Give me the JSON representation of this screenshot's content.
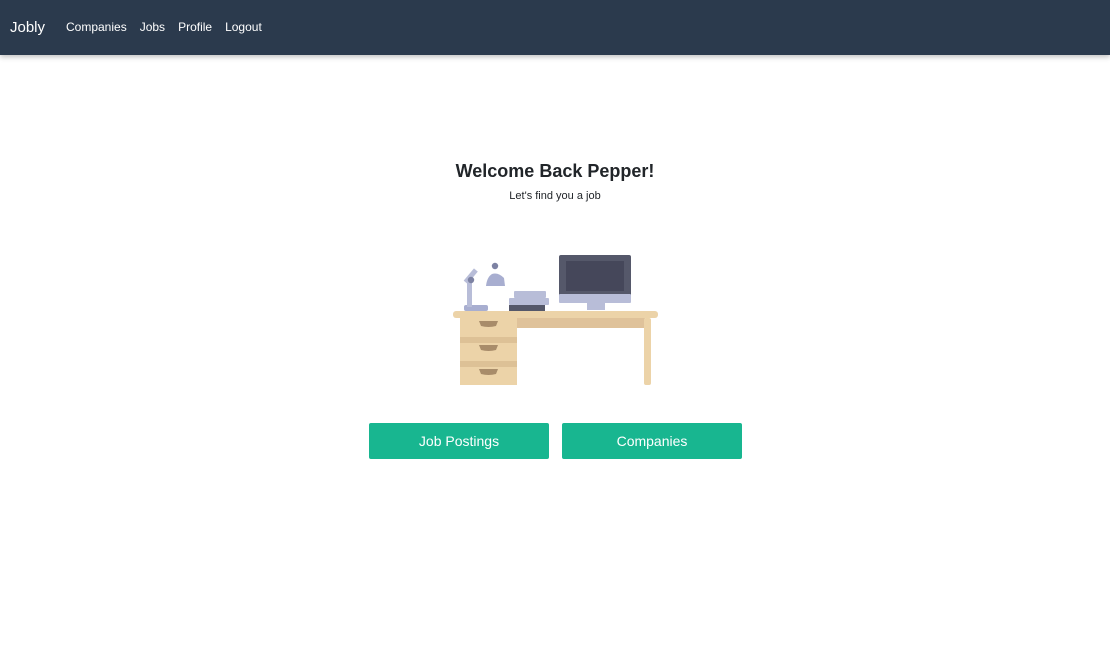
{
  "navbar": {
    "brand": "Jobly",
    "links": [
      {
        "label": "Companies"
      },
      {
        "label": "Jobs"
      },
      {
        "label": "Profile"
      },
      {
        "label": "Logout"
      }
    ],
    "background": "#2b3a4d"
  },
  "hero": {
    "title": "Welcome Back Pepper!",
    "subtitle": "Let's find you a job",
    "illustration_icon": "desk-workspace-illustration"
  },
  "actions": {
    "job_postings_label": "Job Postings",
    "companies_label": "Companies",
    "button_color": "#18b690"
  }
}
